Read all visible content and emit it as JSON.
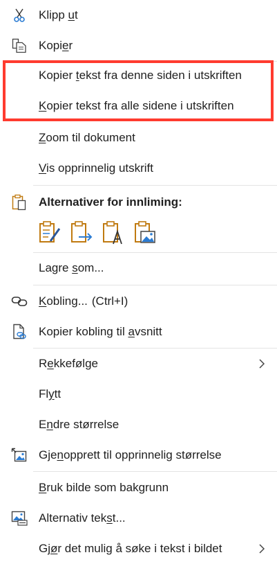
{
  "menu": {
    "items": [
      {
        "id": "cut",
        "pre": "Klipp ",
        "u": "u",
        "post": "t",
        "icon": "scissors-icon"
      },
      {
        "id": "copy",
        "pre": "Kopi",
        "u": "e",
        "post": "r",
        "icon": "copy-icon"
      },
      {
        "id": "copy-page-text",
        "pre": "Kopier ",
        "u": "t",
        "post": "ekst fra denne siden i utskriften"
      },
      {
        "id": "copy-all-text",
        "pre": "",
        "u": "K",
        "post": "opier tekst fra alle sidene i utskriften"
      },
      {
        "id": "zoom-doc",
        "pre": "",
        "u": "Z",
        "post": "oom til dokument"
      },
      {
        "id": "show-original",
        "pre": "",
        "u": "V",
        "post": "is opprinnelig utskrift"
      },
      {
        "id": "save-as",
        "pre": "Lagre ",
        "u": "s",
        "post": "om..."
      },
      {
        "id": "link",
        "pre": "",
        "u": "K",
        "post": "obling...",
        "shortcut": "(Ctrl+I)",
        "icon": "link-icon"
      },
      {
        "id": "copy-link",
        "pre": "Kopier kobling til ",
        "u": "a",
        "post": "vsnitt",
        "icon": "link-document-icon"
      },
      {
        "id": "order",
        "pre": "R",
        "u": "e",
        "post": "kkefølge"
      },
      {
        "id": "move",
        "pre": "Fl",
        "u": "y",
        "post": "tt"
      },
      {
        "id": "resize",
        "pre": "E",
        "u": "n",
        "post": "dre størrelse"
      },
      {
        "id": "reset-size",
        "pre": "Gje",
        "u": "n",
        "post": "opprett til opprinnelig størrelse",
        "icon": "reset-picture-icon"
      },
      {
        "id": "bg",
        "pre": "",
        "u": "B",
        "post": "ruk bilde som bakgrunn"
      },
      {
        "id": "alt-text",
        "pre": "Alternativ tek",
        "u": "s",
        "post": "t...",
        "icon": "alt-text-icon"
      },
      {
        "id": "ocr",
        "pre": "Gj",
        "u": "ø",
        "post": "r det mulig å søke i tekst i bildet"
      }
    ],
    "paste_header": "Alternativer for innliming:",
    "paste_options": [
      "paste-keep-formatting-icon",
      "paste-link-icon",
      "paste-text-only-icon",
      "paste-picture-icon"
    ],
    "accent": "#2b579a",
    "highlight": "#ff3b2f"
  }
}
